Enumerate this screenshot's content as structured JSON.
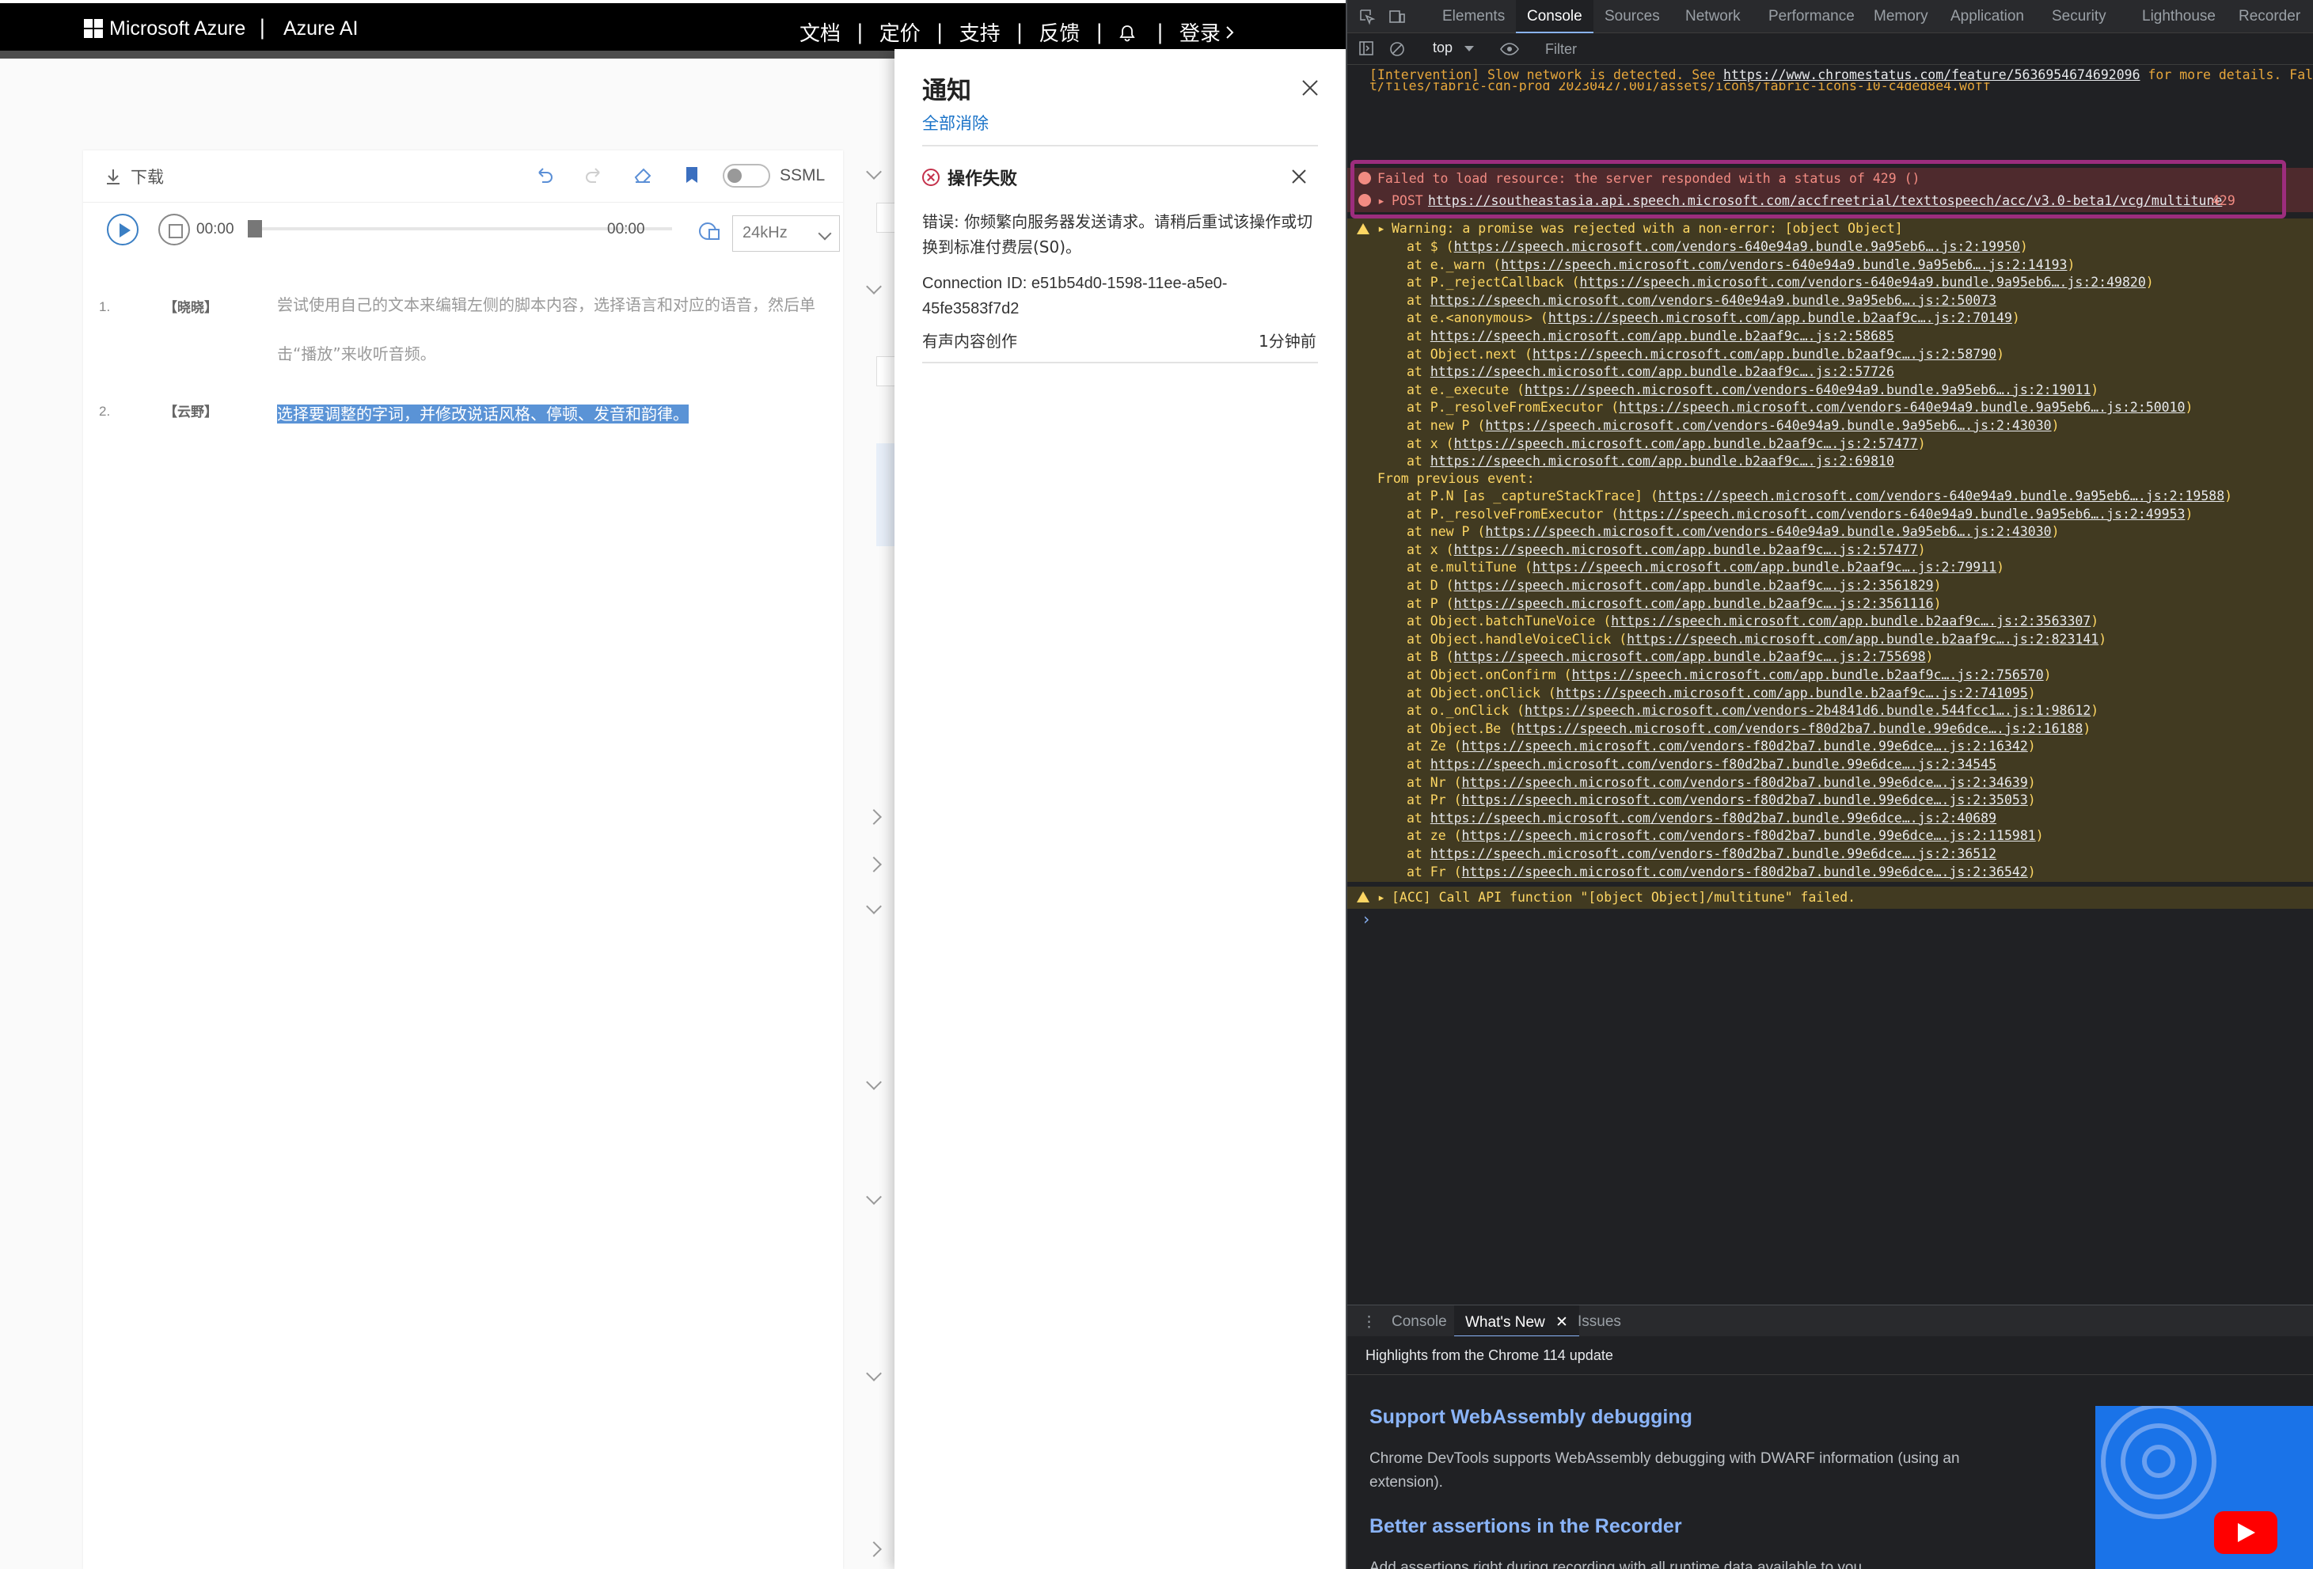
{
  "header": {
    "brand": "Microsoft Azure",
    "separator": "|",
    "product": "Azure AI",
    "links": [
      "文档",
      "定价",
      "支持",
      "反馈"
    ],
    "login": "登录"
  },
  "editor": {
    "download_label": "下载",
    "ssml_label": "SSML",
    "time_start": "00:00",
    "time_end": "00:00",
    "sample_rate": "24kHz",
    "lines": [
      {
        "no": "1.",
        "speaker": "【晓晓】",
        "text": "尝试使用自己的文本来编辑左侧的脚本内容，选择语言和对应的语音，然后单击“播放”来收听音频。"
      },
      {
        "no": "2.",
        "speaker": "【云野】",
        "text": "选择要调整的字词，并修改说话风格、停顿、发音和韵律。"
      }
    ]
  },
  "notification": {
    "title": "通知",
    "clear_all": "全部消除",
    "card_title": "操作失败",
    "message": "错误: 你频繁向服务器发送请求。请稍后重试该操作或切换到标准付费层(S0)。",
    "connection": "Connection ID: e51b54d0-1598-11ee-a5e0-45fe3583f7d2",
    "source": "有声内容创作",
    "time": "1分钟前"
  },
  "devtools": {
    "tabs": [
      "Elements",
      "Console",
      "Sources",
      "Network",
      "Performance",
      "Memory",
      "Application",
      "Security",
      "Lighthouse",
      "Recorder"
    ],
    "active_tab": "Console",
    "context": "top",
    "filter_placeholder": "Filter",
    "console_lines": {
      "intervention": "[Intervention] Slow network is detected. See ",
      "intervention_url": "https://www.chromestatus.com/feature/5636954674692096",
      "intervention_tail": " for more details. Fal",
      "font_line": "t/files/fabric-cdn-prod_20230427.001/assets/icons/fabric-icons-10-c4ded8e4.woff",
      "error1": "Failed to load resource: the server responded with a status of 429 ()",
      "error2_method": "POST ",
      "error2_url": "https://southeastasia.api.speech.microsoft.com/accfreetrial/texttospeech/acc/v3.0-beta1/vcg/multitune",
      "error2_status": "429",
      "warning_head": "Warning: a promise was rejected with a non-error: [object Object]",
      "from_previous": "From previous event:",
      "warning2": "[ACC] Call API function \"[object Object]/multitune\" failed."
    },
    "stack1": [
      {
        "fn": "at $ (",
        "url": "https://speech.microsoft.com/vendors-640e94a9.bundle.9a95eb6….js:2:19950",
        "end": ")"
      },
      {
        "fn": "at e._warn (",
        "url": "https://speech.microsoft.com/vendors-640e94a9.bundle.9a95eb6….js:2:14193",
        "end": ")"
      },
      {
        "fn": "at P._rejectCallback (",
        "url": "https://speech.microsoft.com/vendors-640e94a9.bundle.9a95eb6….js:2:49820",
        "end": ")"
      },
      {
        "fn": "at ",
        "url": "https://speech.microsoft.com/vendors-640e94a9.bundle.9a95eb6….js:2:50073",
        "end": ""
      },
      {
        "fn": "at e.<anonymous> (",
        "url": "https://speech.microsoft.com/app.bundle.b2aaf9c….js:2:70149",
        "end": ")"
      },
      {
        "fn": "at ",
        "url": "https://speech.microsoft.com/app.bundle.b2aaf9c….js:2:58685",
        "end": ""
      },
      {
        "fn": "at Object.next (",
        "url": "https://speech.microsoft.com/app.bundle.b2aaf9c….js:2:58790",
        "end": ")"
      },
      {
        "fn": "at ",
        "url": "https://speech.microsoft.com/app.bundle.b2aaf9c….js:2:57726",
        "end": ""
      },
      {
        "fn": "at e._execute (",
        "url": "https://speech.microsoft.com/vendors-640e94a9.bundle.9a95eb6….js:2:19011",
        "end": ")"
      },
      {
        "fn": "at P._resolveFromExecutor (",
        "url": "https://speech.microsoft.com/vendors-640e94a9.bundle.9a95eb6….js:2:50010",
        "end": ")"
      },
      {
        "fn": "at new P (",
        "url": "https://speech.microsoft.com/vendors-640e94a9.bundle.9a95eb6….js:2:43030",
        "end": ")"
      },
      {
        "fn": "at x (",
        "url": "https://speech.microsoft.com/app.bundle.b2aaf9c….js:2:57477",
        "end": ")"
      },
      {
        "fn": "at ",
        "url": "https://speech.microsoft.com/app.bundle.b2aaf9c….js:2:69810",
        "end": ""
      }
    ],
    "stack2": [
      {
        "fn": "at P.N [as _captureStackTrace] (",
        "url": "https://speech.microsoft.com/vendors-640e94a9.bundle.9a95eb6….js:2:19588",
        "end": ")"
      },
      {
        "fn": "at P._resolveFromExecutor (",
        "url": "https://speech.microsoft.com/vendors-640e94a9.bundle.9a95eb6….js:2:49953",
        "end": ")"
      },
      {
        "fn": "at new P (",
        "url": "https://speech.microsoft.com/vendors-640e94a9.bundle.9a95eb6….js:2:43030",
        "end": ")"
      },
      {
        "fn": "at x (",
        "url": "https://speech.microsoft.com/app.bundle.b2aaf9c….js:2:57477",
        "end": ")"
      },
      {
        "fn": "at e.multiTune (",
        "url": "https://speech.microsoft.com/app.bundle.b2aaf9c….js:2:79911",
        "end": ")"
      },
      {
        "fn": "at D (",
        "url": "https://speech.microsoft.com/app.bundle.b2aaf9c….js:2:3561829",
        "end": ")"
      },
      {
        "fn": "at P (",
        "url": "https://speech.microsoft.com/app.bundle.b2aaf9c….js:2:3561116",
        "end": ")"
      },
      {
        "fn": "at Object.batchTuneVoice (",
        "url": "https://speech.microsoft.com/app.bundle.b2aaf9c….js:2:3563307",
        "end": ")"
      },
      {
        "fn": "at Object.handleVoiceClick (",
        "url": "https://speech.microsoft.com/app.bundle.b2aaf9c….js:2:823141",
        "end": ")"
      },
      {
        "fn": "at B (",
        "url": "https://speech.microsoft.com/app.bundle.b2aaf9c….js:2:755698",
        "end": ")"
      },
      {
        "fn": "at Object.onConfirm (",
        "url": "https://speech.microsoft.com/app.bundle.b2aaf9c….js:2:756570",
        "end": ")"
      },
      {
        "fn": "at Object.onClick (",
        "url": "https://speech.microsoft.com/app.bundle.b2aaf9c….js:2:741095",
        "end": ")"
      },
      {
        "fn": "at o._onClick (",
        "url": "https://speech.microsoft.com/vendors-2b4841d6.bundle.544fcc1….js:1:98612",
        "end": ")"
      },
      {
        "fn": "at Object.Be (",
        "url": "https://speech.microsoft.com/vendors-f80d2ba7.bundle.99e6dce….js:2:16188",
        "end": ")"
      },
      {
        "fn": "at Ze (",
        "url": "https://speech.microsoft.com/vendors-f80d2ba7.bundle.99e6dce….js:2:16342",
        "end": ")"
      },
      {
        "fn": "at ",
        "url": "https://speech.microsoft.com/vendors-f80d2ba7.bundle.99e6dce….js:2:34545",
        "end": ""
      },
      {
        "fn": "at Nr (",
        "url": "https://speech.microsoft.com/vendors-f80d2ba7.bundle.99e6dce….js:2:34639",
        "end": ")"
      },
      {
        "fn": "at Pr (",
        "url": "https://speech.microsoft.com/vendors-f80d2ba7.bundle.99e6dce….js:2:35053",
        "end": ")"
      },
      {
        "fn": "at ",
        "url": "https://speech.microsoft.com/vendors-f80d2ba7.bundle.99e6dce….js:2:40689",
        "end": ""
      },
      {
        "fn": "at ze (",
        "url": "https://speech.microsoft.com/vendors-f80d2ba7.bundle.99e6dce….js:2:115981",
        "end": ")"
      },
      {
        "fn": "at ",
        "url": "https://speech.microsoft.com/vendors-f80d2ba7.bundle.99e6dce….js:2:36512",
        "end": ""
      },
      {
        "fn": "at Fr (",
        "url": "https://speech.microsoft.com/vendors-f80d2ba7.bundle.99e6dce….js:2:36542",
        "end": ")"
      }
    ],
    "drawer_tabs": [
      "Console",
      "What's New",
      "Issues"
    ],
    "drawer_active": "What's New",
    "whats_new": {
      "highlights": "Highlights from the Chrome 114 update",
      "h1": "Support WebAssembly debugging",
      "p1": "Chrome DevTools supports WebAssembly debugging with DWARF information (using an extension).",
      "h2": "Better assertions in the Recorder",
      "p2": "Add assertions right during recording with all runtime data available to you."
    }
  },
  "colors": {
    "error_text": "#f28b82",
    "warning_text": "#fdd663",
    "highlight_border": "#9c2d7d",
    "selection": "#5a93d6"
  }
}
